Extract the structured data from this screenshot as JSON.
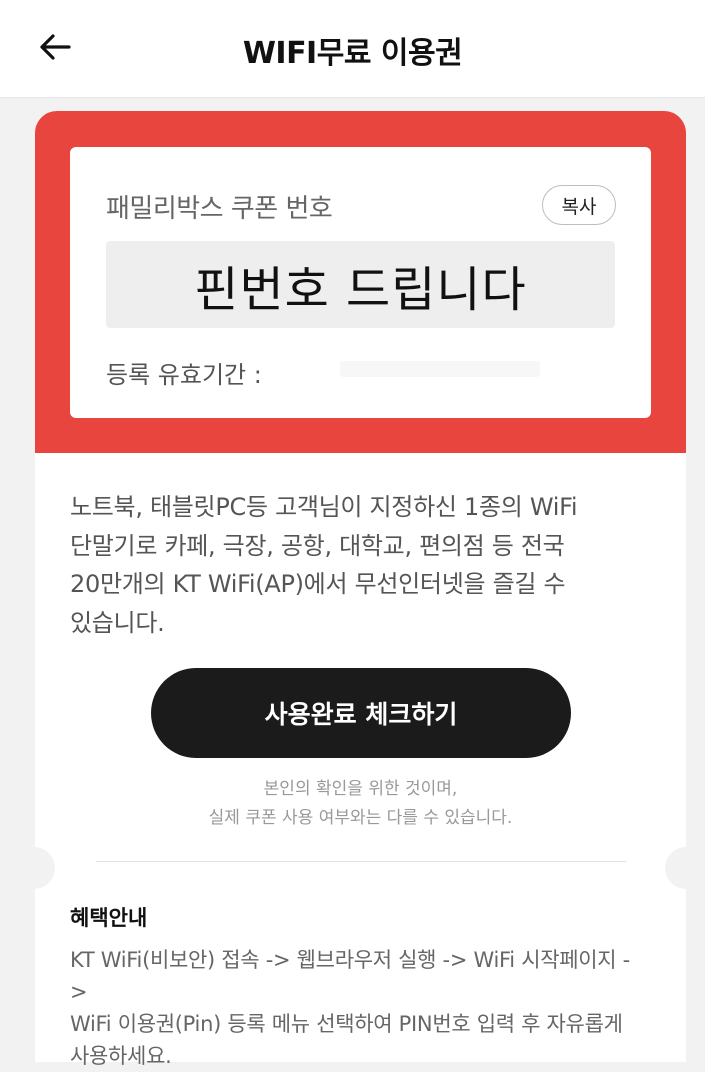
{
  "header": {
    "title": "WIFI무료 이용권",
    "back_icon": "arrow-left-icon"
  },
  "coupon": {
    "label": "패밀리박스 쿠폰 번호",
    "copy_label": "복사",
    "pin": "핀번호 드립니다",
    "validity_label": "등록 유효기간 :"
  },
  "description": {
    "line1": "노트북, 태블릿PC등 고객님이 지정하신 1종의 WiFi",
    "line2": "단말기로 카페, 극장, 공항, 대학교, 편의점 등 전국",
    "line3": "20만개의 KT WiFi(AP)에서 무선인터넷을 즐길 수",
    "line4": "있습니다."
  },
  "check_button": "사용완료 체크하기",
  "notice": {
    "line1": "본인의 확인을 위한 것이며,",
    "line2": "실제 쿠폰 사용 여부와는 다를 수 있습니다."
  },
  "benefit": {
    "title": "혜택안내",
    "line1": " KT WiFi(비보안) 접속 -> 웹브라우저 실행 -> WiFi 시작페이지 ->",
    "line2": "WiFi 이용권(Pin) 등록 메뉴 선택하여 PIN번호 입력 후 자유롭게",
    "line3": "사용하세요."
  },
  "colors": {
    "accent_red": "#e8453f",
    "button_dark": "#1b1b1b",
    "background": "#f2f2f2"
  }
}
